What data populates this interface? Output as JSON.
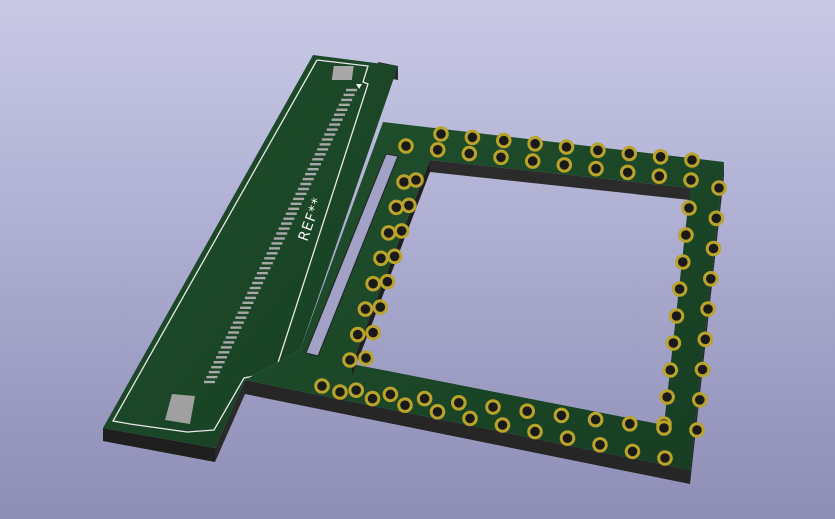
{
  "viewer": {
    "background_top": "#c9c9e6",
    "background_bottom": "#8d8db6"
  },
  "board": {
    "reference_label": "REF**",
    "solder_mask_color": "#1d4a2a",
    "board_edge_color": "#262626",
    "silkscreen_color": "#f4f4f4",
    "pad_gold_color": "#b9a32a",
    "pad_silver_color": "#a8a8a8"
  }
}
